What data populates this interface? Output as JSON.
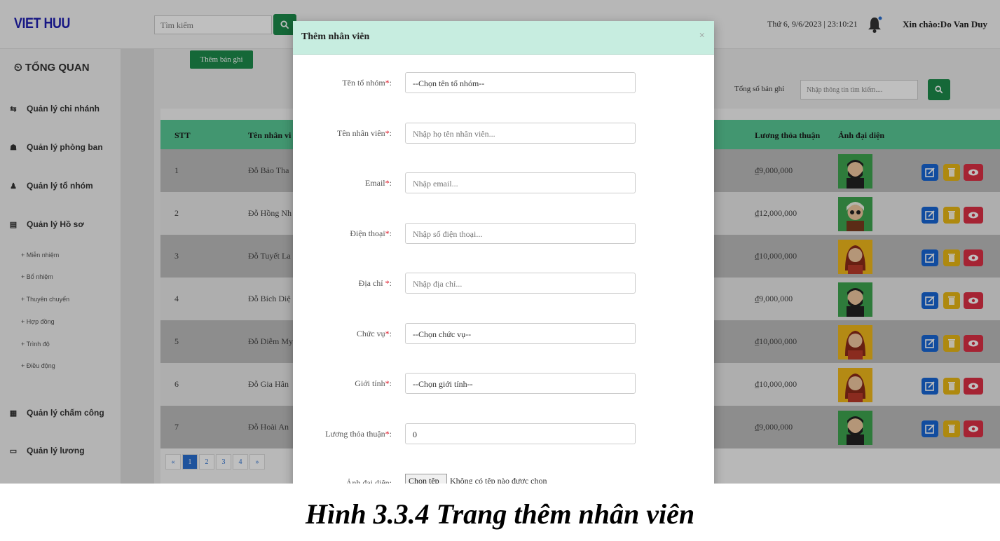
{
  "header": {
    "brand": "VIET HUU",
    "search_placeholder": "Tìm kiếm",
    "datetime": "Thứ 6, 9/6/2023 | 23:10:21",
    "greeting": "Xin chào:Do Van Duy"
  },
  "sidebar": {
    "overview": "TỔNG QUAN",
    "items": [
      {
        "label": "Quản lý chi nhánh",
        "icon": "branch-icon"
      },
      {
        "label": "Quản lý phòng ban",
        "icon": "group-icon"
      },
      {
        "label": "Quản lý tổ nhóm",
        "icon": "team-icon"
      },
      {
        "label": "Quản lý Hồ sơ",
        "icon": "profile-icon"
      }
    ],
    "sub_items": [
      "+ Miễn nhiệm",
      "+ Bổ nhiệm",
      "+ Thuyên chuyển",
      "+ Hợp đồng",
      "+ Trình độ",
      "+ Điều động"
    ],
    "bottom_items": [
      {
        "label": "Quản lý chấm công",
        "icon": "calendar-icon"
      },
      {
        "label": "Quản lý lương",
        "icon": "money-icon"
      }
    ]
  },
  "toolbar": {
    "add_record": "Thêm bản ghi",
    "total_label": "Tổng số   bản ghi",
    "filter_placeholder": "Nhập thông tin tìm kiếm...."
  },
  "table": {
    "headers": {
      "stt": "STT",
      "name": "Tên nhân vi",
      "salary": "Lương thỏa thuận",
      "avatar": "Ảnh đại diện"
    },
    "rows": [
      {
        "stt": "1",
        "name": "Đỗ Bảo Tha",
        "salary": "₫9,000,000",
        "avatar": "male"
      },
      {
        "stt": "2",
        "name": "Đỗ Hồng Nh",
        "salary": "₫12,000,000",
        "avatar": "glasses"
      },
      {
        "stt": "3",
        "name": "Đỗ Tuyết La",
        "salary": "₫10,000,000",
        "avatar": "female"
      },
      {
        "stt": "4",
        "name": "Đỗ Bích Diệ",
        "salary": "₫9,000,000",
        "avatar": "male"
      },
      {
        "stt": "5",
        "name": "Đỗ Diễm My",
        "salary": "₫10,000,000",
        "avatar": "female"
      },
      {
        "stt": "6",
        "name": "Đỗ Gia Hân",
        "salary": "₫10,000,000",
        "avatar": "female"
      },
      {
        "stt": "7",
        "name": "Đỗ Hoài An",
        "salary": "₫9,000,000",
        "avatar": "male"
      }
    ]
  },
  "pagination": {
    "prev": "«",
    "pages": [
      "1",
      "2",
      "3",
      "4"
    ],
    "next": "»",
    "active": "1"
  },
  "modal": {
    "title": "Thêm nhân viên",
    "close": "×",
    "fields": [
      {
        "label": "Tên tổ nhóm",
        "required": "*",
        "suffix": ":",
        "value": "--Chọn tên tổ nhóm--",
        "kind": "select"
      },
      {
        "label": "Tên nhân viên",
        "required": "*",
        "suffix": ":",
        "value": "Nhập họ tên nhân viên...",
        "kind": "input"
      },
      {
        "label": "Email",
        "required": "*",
        "suffix": ":",
        "value": "Nhập email...",
        "kind": "input"
      },
      {
        "label": "Điện thoại",
        "required": "*",
        "suffix": ":",
        "value": "Nhập số điện thoại...",
        "kind": "input"
      },
      {
        "label": "Địa chỉ ",
        "required": "*",
        "suffix": ":",
        "value": "Nhập địa chỉ...",
        "kind": "input"
      },
      {
        "label": "Chức vụ",
        "required": "*",
        "suffix": ":",
        "value": "--Chọn chức vụ--",
        "kind": "select"
      },
      {
        "label": "Giới tính",
        "required": "*",
        "suffix": ":",
        "value": "--Chọn giới tính--",
        "kind": "select"
      },
      {
        "label": "Lương thỏa thuận",
        "required": "*",
        "suffix": ":",
        "value": "0",
        "kind": "value"
      }
    ],
    "file_field": {
      "label": "Ảnh đại diện",
      "suffix": ":",
      "button": "Chọn tệp",
      "status": "Không có tệp nào được chọn"
    }
  },
  "caption": "Hình 3.3.4 Trang thêm nhân viên",
  "colors": {
    "brand": "#1f1fb0",
    "accent_green": "#1c8b4b",
    "table_header": "#58c996",
    "modal_header": "#c7ede0",
    "edit": "#1766d4",
    "delete": "#e8b714",
    "view": "#dc2f45"
  }
}
